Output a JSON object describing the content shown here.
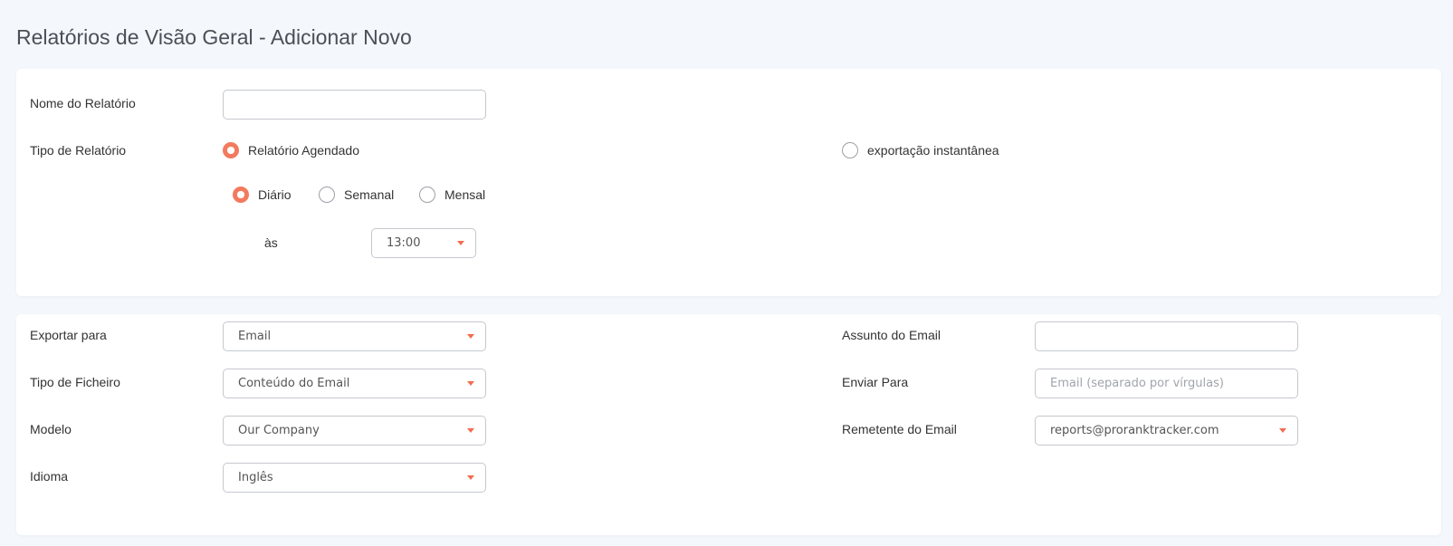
{
  "page": {
    "title": "Relatórios de Visão Geral - Adicionar Novo"
  },
  "general": {
    "report_name_label": "Nome do Relatório",
    "report_name_value": "",
    "report_type_label": "Tipo de Relatório",
    "type_options": [
      {
        "label": "Relatório Agendado",
        "selected": true
      },
      {
        "label": "exportação instantânea",
        "selected": false
      }
    ],
    "frequency_options": [
      {
        "label": "Diário",
        "selected": true
      },
      {
        "label": "Semanal",
        "selected": false
      },
      {
        "label": "Mensal",
        "selected": false
      }
    ],
    "at_label": "às",
    "time_value": "13:00"
  },
  "export": {
    "export_to_label": "Exportar para",
    "export_to_value": "Email",
    "file_type_label": "Tipo de Ficheiro",
    "file_type_value": "Conteúdo do Email",
    "template_label": "Modelo",
    "template_value": "Our Company",
    "language_label": "Idioma",
    "language_value": "Inglês",
    "subject_label": "Assunto do Email",
    "subject_value": "",
    "send_to_label": "Enviar Para",
    "send_to_placeholder": "Email (separado por vírgulas)",
    "sender_label": "Remetente do Email",
    "sender_value": "reports@proranktracker.com"
  },
  "colors": {
    "accent": "#f37a5e",
    "background": "#f4f7fb"
  }
}
